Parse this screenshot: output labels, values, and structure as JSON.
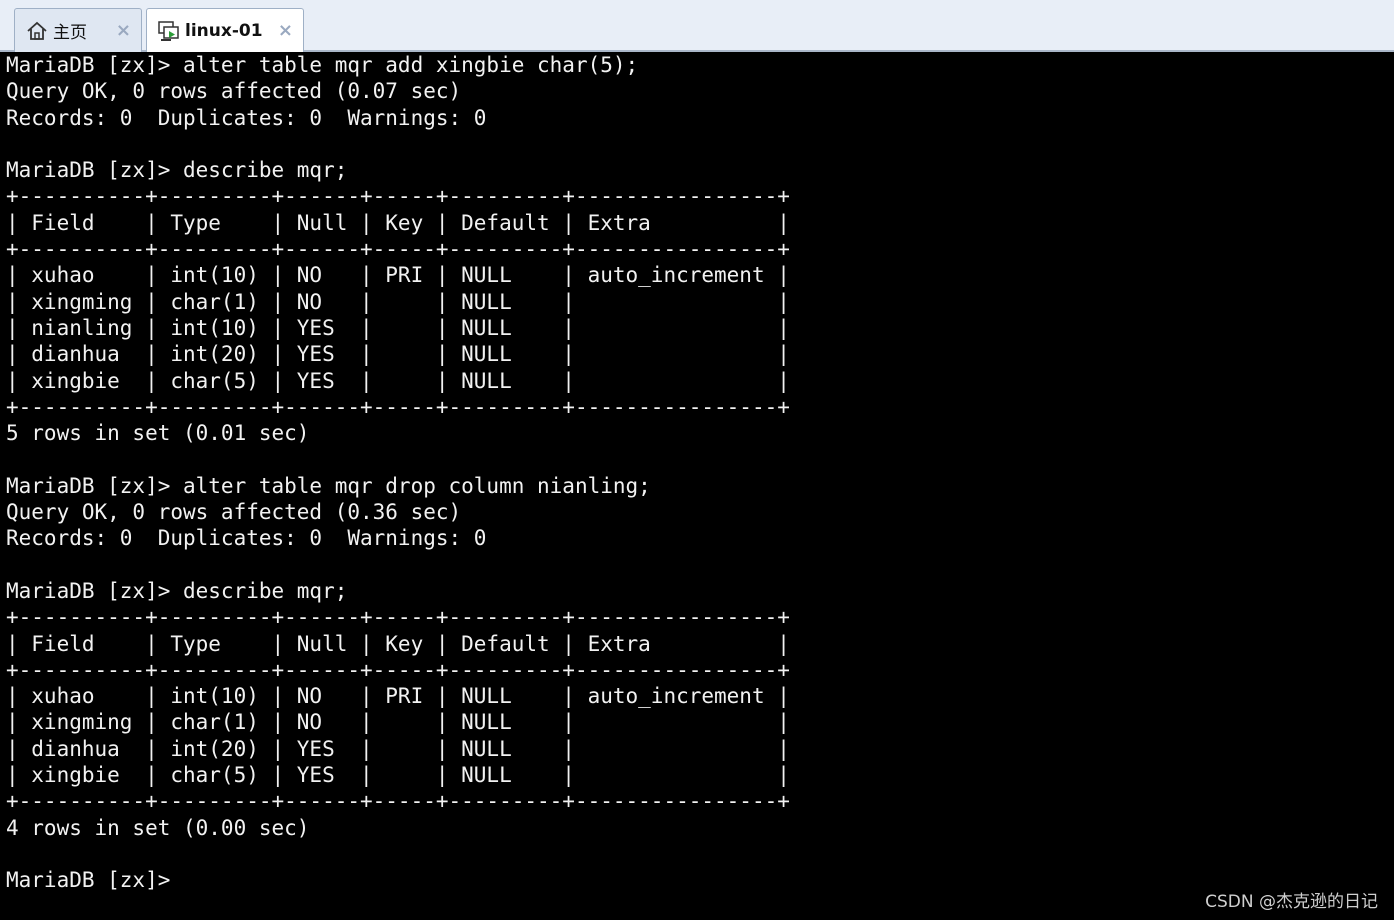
{
  "tabs": [
    {
      "label": "主页",
      "icon": "home-icon",
      "close": "×"
    },
    {
      "label": "linux-01",
      "icon": "vm-screen-icon",
      "close": "×"
    }
  ],
  "terminal": {
    "lines": [
      "MariaDB [zx]> alter table mqr add xingbie char(5);",
      "Query OK, 0 rows affected (0.07 sec)",
      "Records: 0  Duplicates: 0  Warnings: 0",
      "",
      "MariaDB [zx]> describe mqr;",
      "+----------+---------+------+-----+---------+----------------+",
      "| Field    | Type    | Null | Key | Default | Extra          |",
      "+----------+---------+------+-----+---------+----------------+",
      "| xuhao    | int(10) | NO   | PRI | NULL    | auto_increment |",
      "| xingming | char(1) | NO   |     | NULL    |                |",
      "| nianling | int(10) | YES  |     | NULL    |                |",
      "| dianhua  | int(20) | YES  |     | NULL    |                |",
      "| xingbie  | char(5) | YES  |     | NULL    |                |",
      "+----------+---------+------+-----+---------+----------------+",
      "5 rows in set (0.01 sec)",
      "",
      "MariaDB [zx]> alter table mqr drop column nianling;",
      "Query OK, 0 rows affected (0.36 sec)",
      "Records: 0  Duplicates: 0  Warnings: 0",
      "",
      "MariaDB [zx]> describe mqr;",
      "+----------+---------+------+-----+---------+----------------+",
      "| Field    | Type    | Null | Key | Default | Extra          |",
      "+----------+---------+------+-----+---------+----------------+",
      "| xuhao    | int(10) | NO   | PRI | NULL    | auto_increment |",
      "| xingming | char(1) | NO   |     | NULL    |                |",
      "| dianhua  | int(20) | YES  |     | NULL    |                |",
      "| xingbie  | char(5) | YES  |     | NULL    |                |",
      "+----------+---------+------+-----+---------+----------------+",
      "4 rows in set (0.00 sec)",
      "",
      "MariaDB [zx]> "
    ]
  },
  "watermark": "CSDN @杰克逊的日记"
}
